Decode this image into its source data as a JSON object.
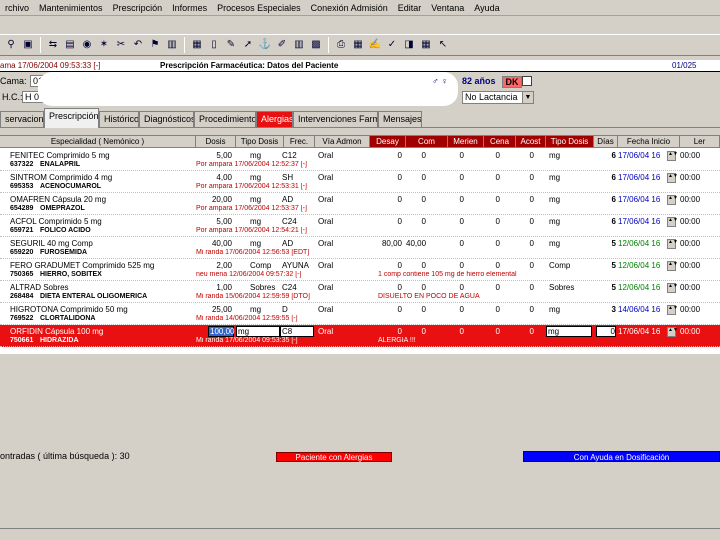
{
  "menu": [
    "rchivo",
    "Mantenimientos",
    "Prescripción",
    "Informes",
    "Procesos Especiales",
    "Conexión Admisión",
    "Editar",
    "Ventana",
    "Ayuda"
  ],
  "toolbar_icons": [
    "binoculars-icon",
    "monitor-icon",
    "transfer-icon",
    "monitor-green-icon",
    "record-icon",
    "wand-icon",
    "scissors-icon",
    "undo-icon",
    "pin-icon",
    "trash-icon",
    "calculator-icon",
    "document-icon",
    "document-edit-icon",
    "document-arrow-icon",
    "anchor-icon",
    "pencil-icon",
    "building-icon",
    "chart-icon",
    "printer-icon",
    "calendar-icon",
    "edit-icon",
    "ruler-icon",
    "bag-icon",
    "table-icon",
    "pointer-icon"
  ],
  "titlebar": {
    "left": "ama 17/06/2004 09:53:33 [-]",
    "center": "Prescripción Farmacéutica: Datos del Paciente",
    "right": "01/025"
  },
  "patient": {
    "label_cama": "Cama:",
    "cama_value": "01 - 2",
    "label_hc": "H.C.:",
    "hc_value": "H 0",
    "anos_label": "82 años",
    "dk_label": "DK",
    "lactancia_value": "No Lactancia"
  },
  "tabs": [
    {
      "label": "servaciones",
      "state": "normal"
    },
    {
      "label": "Prescripción",
      "state": "active"
    },
    {
      "label": "Histórico",
      "state": "normal"
    },
    {
      "label": "Diagnósticos",
      "state": "normal"
    },
    {
      "label": "Procedimientos",
      "state": "normal"
    },
    {
      "label": "Alergias",
      "state": "alert"
    },
    {
      "label": "Intervenciones Farmacéuticas",
      "state": "normal"
    },
    {
      "label": "Mensajes",
      "state": "normal"
    }
  ],
  "grid": {
    "headers": [
      {
        "label": "Especialidad ( Nemónico )",
        "style": "normal"
      },
      {
        "label": "Dosis",
        "style": "normal"
      },
      {
        "label": "Tipo Dosis",
        "style": "normal"
      },
      {
        "label": "Frec.",
        "style": "normal"
      },
      {
        "label": "Vía Admon",
        "style": "normal"
      },
      {
        "label": "Desay",
        "style": "red"
      },
      {
        "label": "Com",
        "style": "red"
      },
      {
        "label": "Merien",
        "style": "red"
      },
      {
        "label": "Cena",
        "style": "red"
      },
      {
        "label": "Acost",
        "style": "red"
      },
      {
        "label": "Tipo Dosis",
        "style": "red"
      },
      {
        "label": "Días",
        "style": "normal"
      },
      {
        "label": "Fecha Inicio",
        "style": "normal"
      },
      {
        "label": "Ler",
        "style": "normal"
      }
    ],
    "rows": [
      {
        "name": "FENITEC Comprimido 5 mg",
        "code": "637322",
        "generic": "ENALAPRIL",
        "note": "Por ampara 17/06/2004 12:52:37 [-]",
        "dosis": "5,00",
        "tipo": "mg",
        "frec": "C12",
        "via": "Oral",
        "desay": "0",
        "com": "0",
        "merien": "0",
        "cena": "0",
        "acost": "0",
        "tipo2": "mg",
        "dias": "6",
        "fecha": "17/06/04 16",
        "hora": "00:00",
        "date_color": "blue"
      },
      {
        "name": "SINTROM Comprimido 4 mg",
        "code": "695353",
        "generic": "ACENOCUMAROL",
        "note": "Por ampara 17/06/2004 12:53:31 [-]",
        "dosis": "4,00",
        "tipo": "mg",
        "frec": "SH",
        "via": "Oral",
        "desay": "0",
        "com": "0",
        "merien": "0",
        "cena": "0",
        "acost": "0",
        "tipo2": "mg",
        "dias": "6",
        "fecha": "17/06/04 16",
        "hora": "00:00",
        "date_color": "blue"
      },
      {
        "name": "OMAFREN Cápsula 20 mg",
        "code": "654289",
        "generic": "OMEPRAZOL",
        "note": "Por ampara 17/06/2004 12:53:37 [-]",
        "dosis": "20,00",
        "tipo": "mg",
        "frec": "AD",
        "via": "Oral",
        "desay": "0",
        "com": "0",
        "merien": "0",
        "cena": "0",
        "acost": "0",
        "tipo2": "mg",
        "dias": "6",
        "fecha": "17/06/04 16",
        "hora": "00:00",
        "date_color": "blue"
      },
      {
        "name": "ACFOL Comprimido 5 mg",
        "code": "659721",
        "generic": "FOLICO ACIDO",
        "note": "Por ampara 17/06/2004 12:54:21 [-]",
        "dosis": "5,00",
        "tipo": "mg",
        "frec": "C24",
        "via": "Oral",
        "desay": "0",
        "com": "0",
        "merien": "0",
        "cena": "0",
        "acost": "0",
        "tipo2": "mg",
        "dias": "6",
        "fecha": "17/06/04 16",
        "hora": "00:00",
        "date_color": "blue"
      },
      {
        "name": "SEGURIL 40 mg Comp",
        "code": "659220",
        "generic": "FUROSEMIDA",
        "note": "Mi randa 17/06/2004 12:56:53 [EDT]",
        "dosis": "40,00",
        "tipo": "mg",
        "frec": "AD",
        "via": "Oral",
        "desay": "80,00",
        "com": "40,00",
        "merien": "0",
        "cena": "0",
        "acost": "0",
        "tipo2": "mg",
        "dias": "5",
        "fecha": "12/06/04 16",
        "hora": "00:00",
        "date_color": "green"
      },
      {
        "name": "FERO GRADUMET Comprimido 525 mg",
        "code": "750365",
        "generic": "HIERRO, SOBITEX",
        "note": "neu mena 12/06/2004 09:57:32 [-]",
        "dosis": "2,00",
        "tipo": "Comp",
        "frec": "AYUNA",
        "via": "Oral",
        "desay": "0",
        "com": "0",
        "merien": "0",
        "cena": "0",
        "acost": "0",
        "tipo2": "Comp",
        "dias": "5",
        "fecha": "12/06/04 16",
        "hora": "00:00",
        "date_color": "green",
        "warn": "1 comp contiene 105 mg de hierro elemental"
      },
      {
        "name": "ALTRAD Sobres",
        "code": "268484",
        "generic": "DIETA ENTERAL OLIGOMERICA",
        "note": "Mi randa 15/06/2004 12:59:59 [DTO]",
        "dosis": "1,00",
        "tipo": "Sobres",
        "frec": "C24",
        "via": "Oral",
        "desay": "0",
        "com": "0",
        "merien": "0",
        "cena": "0",
        "acost": "0",
        "tipo2": "Sobres",
        "dias": "5",
        "fecha": "12/06/04 16",
        "hora": "00:00",
        "date_color": "green",
        "warn": "DISUELTO EN POCO DE AGUA"
      },
      {
        "name": "HIGROTONA Comprimido 50 mg",
        "code": "769522",
        "generic": "CLORTALIDONA",
        "note": "Mi randa 14/06/2004 12:59:55 [-]",
        "dosis": "25,00",
        "tipo": "mg",
        "frec": "D",
        "via": "Oral",
        "desay": "0",
        "com": "0",
        "merien": "0",
        "cena": "0",
        "acost": "0",
        "tipo2": "mg",
        "dias": "3",
        "fecha": "14/06/04 16",
        "hora": "00:00",
        "date_color": "blue"
      },
      {
        "name": "ORFIDIN Cápsula 100 mg",
        "code": "750661",
        "generic": "HIDRAZIDA",
        "note": "Mi randa 17/06/2004 09:53:35 [-]",
        "dosis": "100,00",
        "tipo": "mg",
        "frec": "C8",
        "via": "Oral",
        "desay": "0",
        "com": "0",
        "merien": "0",
        "cena": "0",
        "acost": "0",
        "tipo2": "mg",
        "dias": "0",
        "fecha": "17/06/04 16",
        "hora": "00:00",
        "date_color": "red",
        "selected": true,
        "warn": "ALERGIA !!!"
      }
    ]
  },
  "status": {
    "count_text": "ontradas ( última búsqueda ): 30",
    "alert_label": "Paciente con Alergias",
    "help_label": "Con Ayuda en Dosificación"
  }
}
